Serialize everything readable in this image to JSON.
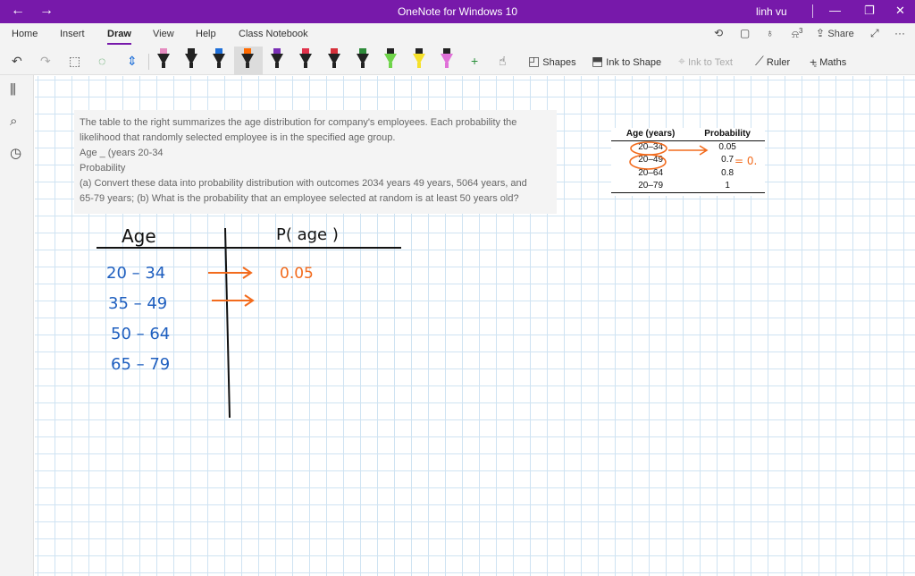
{
  "window": {
    "title": "OneNote for Windows 10",
    "user": "linh vu",
    "back_glyph": "←",
    "forward_glyph": "→",
    "minimize_glyph": "—",
    "restore_glyph": "❐",
    "close_glyph": "✕"
  },
  "tabs": [
    "Home",
    "Insert",
    "Draw",
    "View",
    "Help",
    "Class Notebook"
  ],
  "active_tab": "Draw",
  "tab_right": {
    "share_label": "Share",
    "notification_count": "3"
  },
  "toolbar": {
    "shapes_label": "Shapes",
    "ink_to_shape_label": "Ink to Shape",
    "ink_to_text_label": "Ink to Text",
    "ruler_label": "Ruler",
    "maths_label": "Maths"
  },
  "pens": [
    {
      "color": "#e58cc0",
      "kind": "pen"
    },
    {
      "color": "#222222",
      "kind": "pen"
    },
    {
      "color": "#1e6fd9",
      "kind": "pen"
    },
    {
      "color": "#ff6a00",
      "kind": "pen",
      "selected": true
    },
    {
      "color": "#7a2fb5",
      "kind": "pen"
    },
    {
      "color": "#e0324b",
      "kind": "pen"
    },
    {
      "color": "#d6303a",
      "kind": "pen"
    },
    {
      "color": "#2e8b3a",
      "kind": "pen"
    },
    {
      "color": "#6fd44a",
      "kind": "highlighter"
    },
    {
      "color": "#f5e02a",
      "kind": "highlighter"
    },
    {
      "color": "#e070d8",
      "kind": "highlighter"
    }
  ],
  "problem": {
    "lines": [
      "The table to the right summarizes the age distribution for company's employees. Each probability the",
      "likelihood that randomly selected employee is in the specified age group.",
      "Age _ (years 20-34",
      "Probability",
      "(a) Convert these data into probability distribution with outcomes 2034 years 49 years, 5064 years, and",
      "65-79 years; (b) What is the probability that an employee selected at random is at least 50 years old?"
    ]
  },
  "reference_table": {
    "headers": [
      "Age (years)",
      "Probability"
    ],
    "rows": [
      [
        "20–34",
        "0.05"
      ],
      [
        "20–49",
        "0.7"
      ],
      [
        "20–64",
        "0.8"
      ],
      [
        "20–79",
        "1"
      ]
    ]
  },
  "handwriting": {
    "col_age": "Age",
    "col_prob": "P( age )",
    "rows": [
      "20 – 34",
      "35 – 49",
      "50 – 64",
      "65 – 79"
    ],
    "first_value": "0.05",
    "table_annotation": "= 0.",
    "ink_blue": "#1f5fbf",
    "ink_orange": "#f26b1d",
    "ink_black": "#111111"
  }
}
